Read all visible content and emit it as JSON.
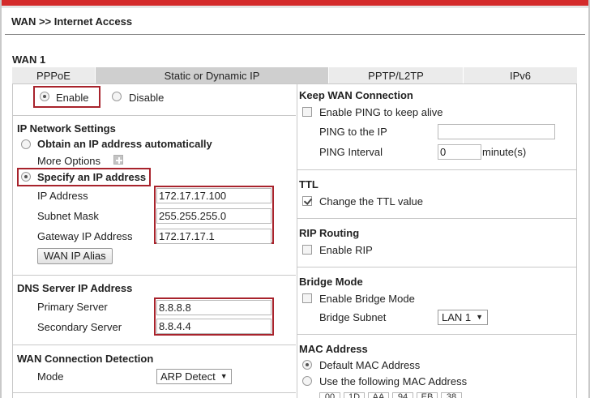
{
  "breadcrumb": "WAN >> Internet Access",
  "wan_label": "WAN 1",
  "tabs": [
    {
      "label": "PPPoE"
    },
    {
      "label": "Static or Dynamic IP"
    },
    {
      "label": "PPTP/L2TP"
    },
    {
      "label": "IPv6"
    }
  ],
  "left": {
    "enable_label": "Enable",
    "disable_label": "Disable",
    "ip_settings_title": "IP Network Settings",
    "obtain_auto_label": "Obtain an IP address automatically",
    "more_options_label": "More Options",
    "specify_label": "Specify an IP address",
    "ip_address_label": "IP Address",
    "ip_address_value": "172.17.17.100",
    "subnet_label": "Subnet Mask",
    "subnet_value": "255.255.255.0",
    "gateway_label": "Gateway IP Address",
    "gateway_value": "172.17.17.1",
    "wan_alias_button": "WAN IP Alias",
    "dns_title": "DNS Server IP Address",
    "primary_label": "Primary Server",
    "primary_value": "8.8.8.8",
    "secondary_label": "Secondary Server",
    "secondary_value": "8.8.4.4",
    "detection_title": "WAN Connection Detection",
    "mode_label": "Mode",
    "mode_value": "ARP Detect"
  },
  "right": {
    "keep_title": "Keep WAN Connection",
    "ping_enable_label": "Enable PING to keep alive",
    "ping_ip_label": "PING to the IP",
    "ping_ip_value": "",
    "ping_interval_label": "PING Interval",
    "ping_interval_value": "0",
    "ping_interval_unit": "minute(s)",
    "ttl_title": "TTL",
    "ttl_label": "Change the TTL value",
    "rip_title": "RIP Routing",
    "rip_label": "Enable RIP",
    "bridge_title": "Bridge Mode",
    "bridge_enable_label": "Enable Bridge Mode",
    "bridge_subnet_label": "Bridge Subnet",
    "bridge_subnet_value": "LAN 1",
    "mac_title": "MAC Address",
    "mac_default_label": "Default MAC Address",
    "mac_custom_label": "Use the following MAC Address",
    "mac_bytes": [
      "00",
      "1D",
      "AA",
      "94",
      "EB",
      "38"
    ]
  },
  "colors": {
    "accent_red": "#d42b2b",
    "highlight_box": "#a8232c",
    "active_tab": "#cfcfcf",
    "inactive_tab": "#ebebeb"
  }
}
